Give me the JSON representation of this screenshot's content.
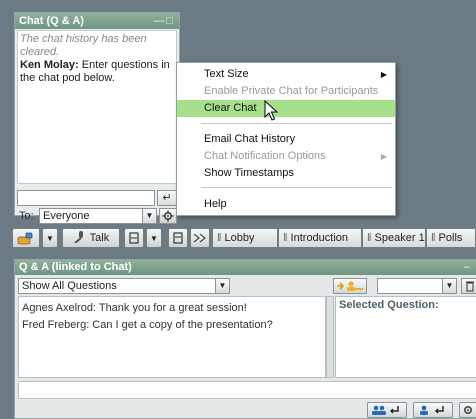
{
  "chat_pod": {
    "title": "Chat (Q & A)",
    "window_controls": "—□",
    "history": {
      "system_message": "The chat history has been cleared.",
      "author": "Ken Molay:",
      "message": " Enter questions in the chat pod below."
    },
    "input_value": "",
    "send_icon": "↵",
    "to_label": "To:",
    "recipient": "Everyone",
    "options_icon": "gear-icon"
  },
  "context_menu": {
    "items": [
      {
        "label": "Text Size",
        "state": "enabled",
        "submenu": true
      },
      {
        "label": "Enable Private Chat for Participants",
        "state": "disabled",
        "submenu": false
      },
      {
        "label": "Clear Chat",
        "state": "highlighted",
        "submenu": false
      },
      {
        "label": "Email Chat History",
        "state": "enabled",
        "submenu": false
      },
      {
        "label": "Chat Notification Options",
        "state": "disabled",
        "submenu": true
      },
      {
        "label": "Show Timestamps",
        "state": "enabled",
        "submenu": false
      },
      {
        "label": "Help",
        "state": "enabled",
        "submenu": false
      }
    ],
    "submenu_arrow": "▶"
  },
  "toolbar": {
    "talk_label": "Talk",
    "tabs": [
      "Lobby",
      "Introduction",
      "Speaker 1",
      "Polls"
    ],
    "dropdown_arrow": "▼"
  },
  "qa_pod": {
    "title": "Q & A (linked to Chat)",
    "window_controls": "–",
    "filter_value": "Show All Questions",
    "questions": [
      "Agnes Axelrod: Thank you for a great session!",
      "Fred Freberg: Can I get a copy of the presentation?"
    ],
    "selected_header": "Selected Question:",
    "answer_value": ""
  },
  "colors": {
    "pod_header": "#7da28d",
    "menu_highlight": "#a6e08a",
    "background": "#6b7a83"
  }
}
